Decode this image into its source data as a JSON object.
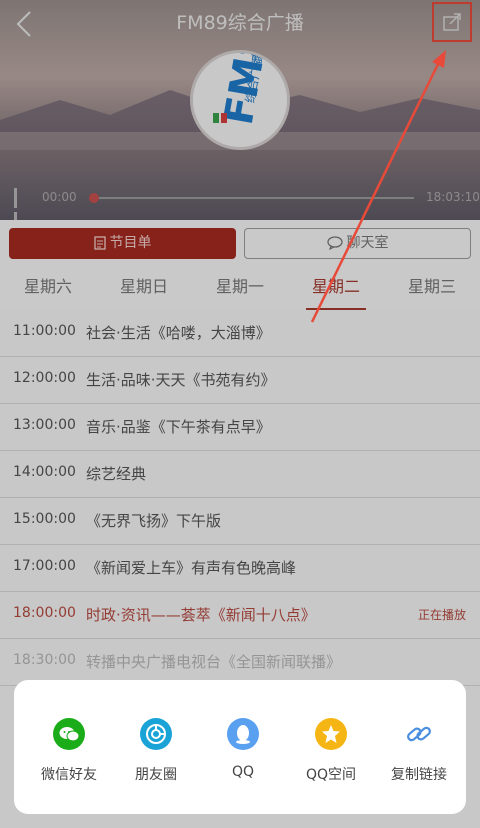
{
  "header": {
    "title": "FM89综合广播"
  },
  "logo": {
    "text": "濮博综合广播"
  },
  "player": {
    "elapsed": "00:00",
    "duration": "18:03:10",
    "progress": 0.0
  },
  "toggle": {
    "schedule_label": "节目单",
    "chat_label": "聊天室"
  },
  "days": [
    {
      "label": "星期六"
    },
    {
      "label": "星期日"
    },
    {
      "label": "星期一"
    },
    {
      "label": "星期二"
    },
    {
      "label": "星期三"
    }
  ],
  "schedule": [
    {
      "time": "11:00:00",
      "name": "社会·生活《哈喽，大淄博》",
      "status": ""
    },
    {
      "time": "12:00:00",
      "name": "生活·品味·天天《书苑有约》",
      "status": ""
    },
    {
      "time": "13:00:00",
      "name": "音乐·品鉴《下午茶有点早》",
      "status": ""
    },
    {
      "time": "14:00:00",
      "name": "综艺经典",
      "status": ""
    },
    {
      "time": "15:00:00",
      "name": "《无界飞扬》下午版",
      "status": ""
    },
    {
      "time": "17:00:00",
      "name": "《新闻爱上车》有声有色晚高峰",
      "status": ""
    },
    {
      "time": "18:00:00",
      "name": "时政·资讯——荟萃《新闻十八点》",
      "status": "正在播放"
    },
    {
      "time": "18:30:00",
      "name": "转播中央广播电视台《全国新闻联播》",
      "status": ""
    }
  ],
  "share_sheet": [
    {
      "label": "微信好友",
      "icon": "wechat-icon",
      "color": "#1aad19"
    },
    {
      "label": "朋友圈",
      "icon": "moments-icon",
      "color": "#1aa3d6"
    },
    {
      "label": "QQ",
      "icon": "qq-icon",
      "color": "#5aa0f0"
    },
    {
      "label": "QQ空间",
      "icon": "qzone-icon",
      "color": "#f5b514"
    },
    {
      "label": "复制链接",
      "icon": "link-icon",
      "color": "#4a8ee0"
    }
  ],
  "colors": {
    "accent": "#a52a22",
    "annotation": "#e84a3a"
  }
}
